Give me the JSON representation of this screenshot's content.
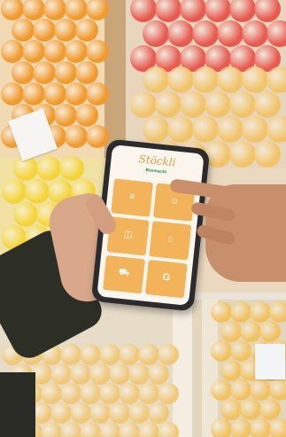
{
  "app": {
    "logo_script": "Stöckli",
    "brand": "Biomarkt",
    "tiles": [
      {
        "icon": "list-icon",
        "glyph": "≡",
        "label": ""
      },
      {
        "icon": "person-icon",
        "glyph": "☺",
        "label": ""
      },
      {
        "icon": "bag-icon",
        "glyph": "◫",
        "label": ""
      },
      {
        "icon": "tag-icon",
        "glyph": "⌂",
        "label": ""
      },
      {
        "icon": "cart-icon",
        "glyph": "⛟",
        "label": ""
      },
      {
        "icon": "g-icon",
        "glyph": "G",
        "label": ""
      }
    ]
  },
  "colors": {
    "tile": "#f2b35a",
    "accent_orange": "#e09a3a",
    "brand_green": "#2e7a3a"
  }
}
